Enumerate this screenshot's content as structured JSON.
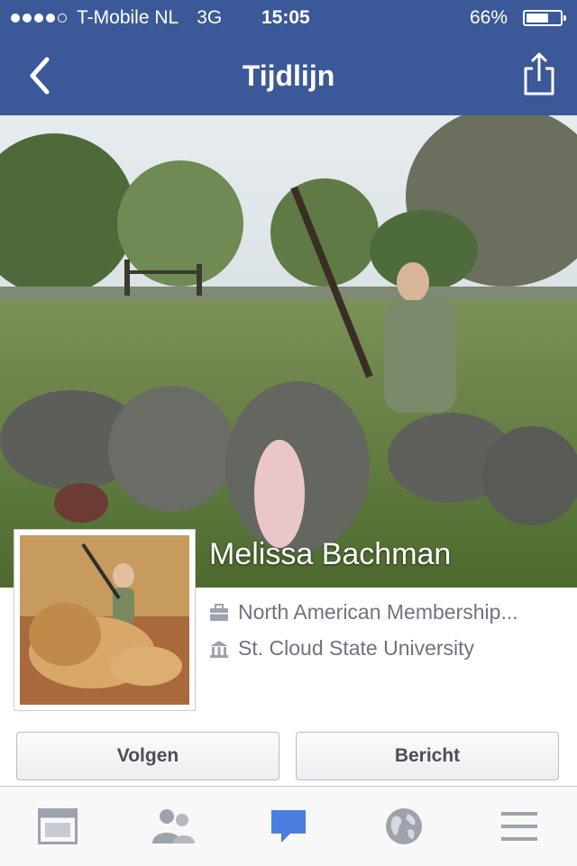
{
  "status_bar": {
    "signal_dots": [
      true,
      true,
      true,
      true,
      false
    ],
    "carrier": "T-Mobile NL",
    "network": "3G",
    "time": "15:05",
    "battery_percent": "66%",
    "battery_level": 0.66
  },
  "nav": {
    "title": "Tijdlijn",
    "back_icon": "chevron-left-icon",
    "share_icon": "share-icon"
  },
  "profile": {
    "name": "Melissa Bachman",
    "work": "North American Membership...",
    "education": "St. Cloud State University"
  },
  "actions": {
    "follow_label": "Volgen",
    "message_label": "Bericht"
  },
  "tab_bar": {
    "items": [
      {
        "icon": "news-feed-icon",
        "active": false
      },
      {
        "icon": "friends-icon",
        "active": false
      },
      {
        "icon": "messages-icon",
        "active": true
      },
      {
        "icon": "globe-icon",
        "active": false
      },
      {
        "icon": "menu-icon",
        "active": false
      }
    ]
  },
  "colors": {
    "brand_blue": "#3b5998",
    "active_tab": "#4c7de0",
    "inactive_tab": "#9da3ad",
    "info_text": "#6d7480"
  }
}
